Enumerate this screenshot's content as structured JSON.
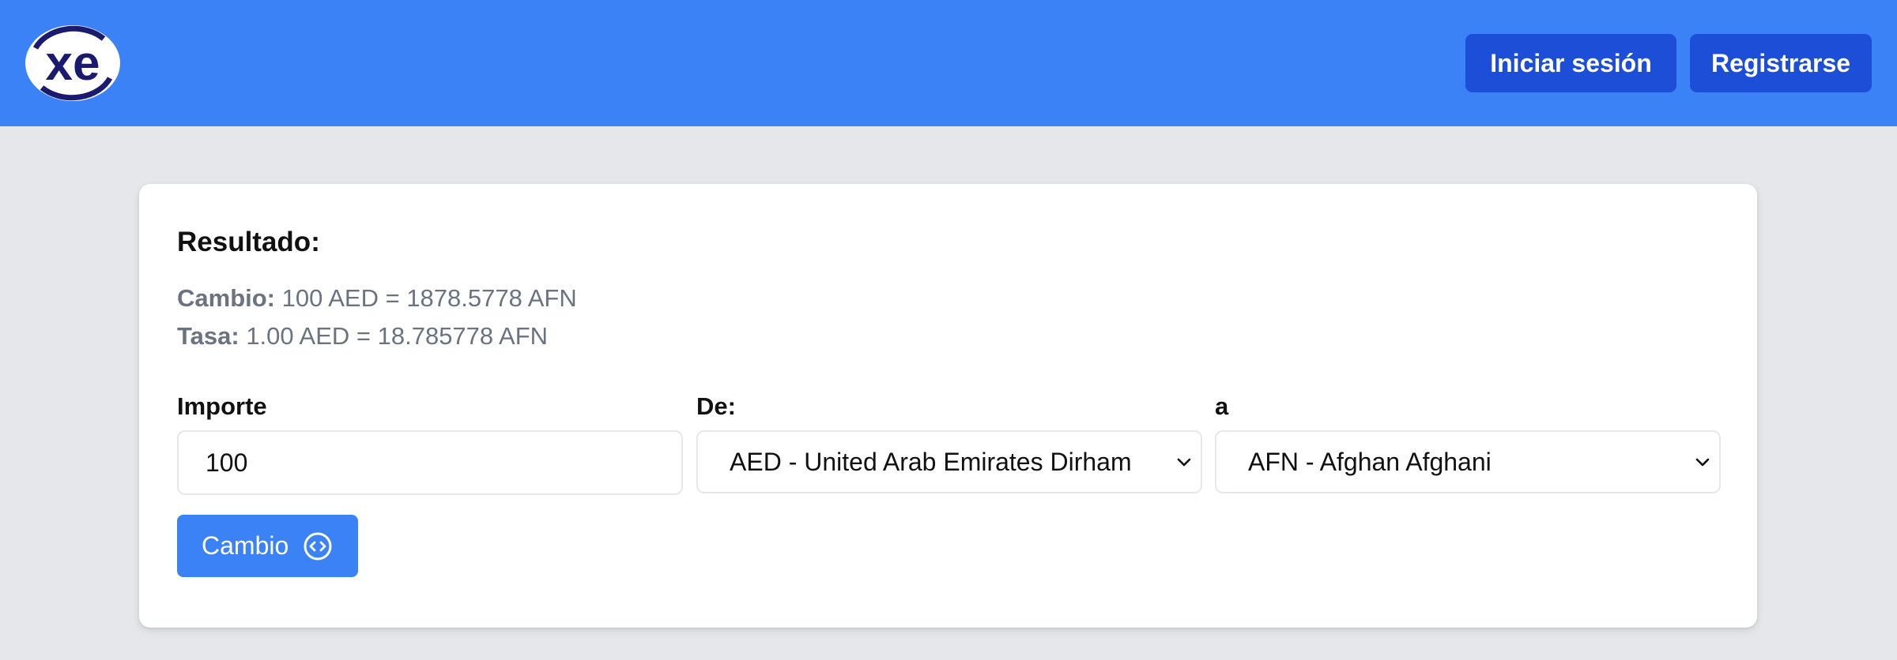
{
  "brand": {
    "logo_text": "xe",
    "logo_color": "#1a1a6e",
    "nav_color": "#3b82f6",
    "button_color": "#1d4ed8"
  },
  "nav": {
    "login_label": "Iniciar sesión",
    "register_label": "Registrarse"
  },
  "result": {
    "title": "Resultado:",
    "exchange_label": "Cambio:",
    "exchange_value": "100 AED = 1878.5778 AFN",
    "rate_label": "Tasa:",
    "rate_value": "1.00 AED = 18.785778 AFN"
  },
  "form": {
    "amount_label": "Importe",
    "amount_value": "100",
    "from_label": "De:",
    "from_selected": "AED - United Arab Emirates Dirham",
    "to_label": "a",
    "to_selected": "AFN - Afghan Afghani",
    "convert_label": "Cambio",
    "convert_icon": "swap-circle-icon"
  }
}
